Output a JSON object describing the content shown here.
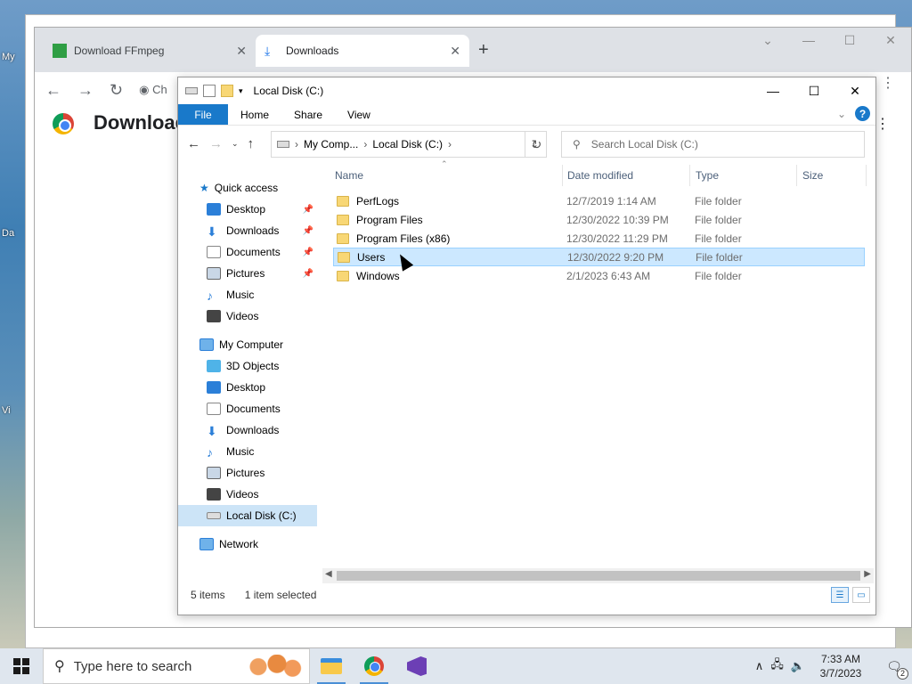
{
  "desktop": {
    "labels": [
      "My",
      "Da",
      "Vi"
    ]
  },
  "chrome": {
    "tabs": [
      {
        "label": "Download FFmpeg",
        "close": "✕"
      },
      {
        "label": "Downloads",
        "close": "✕"
      }
    ],
    "new_tab": "+",
    "omnibox_prefix": "Ch",
    "page_title": "Download",
    "window_controls": [
      "⌄",
      "—",
      "☐",
      "✕"
    ],
    "more": "⋮"
  },
  "explorer": {
    "title": "Local Disk (C:)",
    "window_controls": [
      "—",
      "☐",
      "✕"
    ],
    "ribbon_tabs": [
      "File",
      "Home",
      "Share",
      "View"
    ],
    "help": "?",
    "address": {
      "segments": [
        "My Comp...",
        "Local Disk (C:)"
      ],
      "separator": "›"
    },
    "search_placeholder": "Search Local Disk (C:)",
    "nav": {
      "quick_access": "Quick access",
      "quick_items": [
        {
          "label": "Desktop",
          "icon": "desktop-icon",
          "pinned": true
        },
        {
          "label": "Downloads",
          "icon": "download-icon",
          "pinned": true
        },
        {
          "label": "Documents",
          "icon": "documents-icon",
          "pinned": true
        },
        {
          "label": "Pictures",
          "icon": "pictures-icon",
          "pinned": true
        },
        {
          "label": "Music",
          "icon": "music-icon",
          "pinned": false
        },
        {
          "label": "Videos",
          "icon": "videos-icon",
          "pinned": false
        }
      ],
      "my_computer": "My Computer",
      "computer_items": [
        {
          "label": "3D Objects",
          "icon": "3d-objects-icon"
        },
        {
          "label": "Desktop",
          "icon": "desktop-icon"
        },
        {
          "label": "Documents",
          "icon": "documents-icon"
        },
        {
          "label": "Downloads",
          "icon": "download-icon"
        },
        {
          "label": "Music",
          "icon": "music-icon"
        },
        {
          "label": "Pictures",
          "icon": "pictures-icon"
        },
        {
          "label": "Videos",
          "icon": "videos-icon"
        },
        {
          "label": "Local Disk (C:)",
          "icon": "drive-icon",
          "selected": true
        }
      ],
      "network": "Network"
    },
    "columns": [
      "Name",
      "Date modified",
      "Type",
      "Size"
    ],
    "files": [
      {
        "name": "PerfLogs",
        "date": "12/7/2019 1:14 AM",
        "type": "File folder"
      },
      {
        "name": "Program Files",
        "date": "12/30/2022 10:39 PM",
        "type": "File folder"
      },
      {
        "name": "Program Files (x86)",
        "date": "12/30/2022 11:29 PM",
        "type": "File folder"
      },
      {
        "name": "Users",
        "date": "12/30/2022 9:20 PM",
        "type": "File folder",
        "selected": true
      },
      {
        "name": "Windows",
        "date": "2/1/2023 6:43 AM",
        "type": "File folder"
      }
    ],
    "status": {
      "items": "5 items",
      "selected": "1 item selected"
    },
    "colors": {
      "accent": "#1979ca",
      "selection": "#cce8ff",
      "folder": "#f8d775"
    }
  },
  "taskbar": {
    "search_placeholder": "Type here to search",
    "clock_time": "7:33 AM",
    "clock_date": "3/7/2023",
    "notification_count": "2",
    "apps": [
      "file-explorer-icon",
      "chrome-icon",
      "visual-studio-icon"
    ]
  }
}
